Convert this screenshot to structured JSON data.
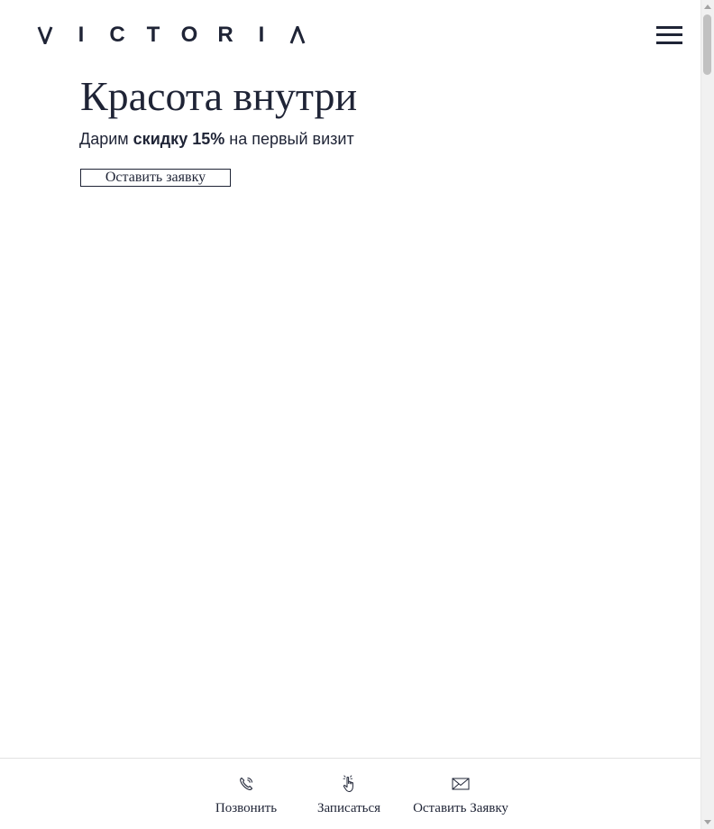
{
  "header": {
    "logo_letters": [
      "V",
      "I",
      "C",
      "T",
      "O",
      "R",
      "I",
      "Λ"
    ],
    "menu_icon": "hamburger-menu-icon"
  },
  "hero": {
    "title": "Красота внутри",
    "subtitle_before": "Дарим",
    "subtitle_bold": "скидку 15%",
    "subtitle_after": "на первый визит",
    "cta_label": "Оставить заявку"
  },
  "bottom_bar": {
    "items": [
      {
        "label": "Позвонить",
        "icon": "phone-icon"
      },
      {
        "label": "Записаться",
        "icon": "tap-hand-icon"
      },
      {
        "label": "Оставить Заявку",
        "icon": "envelope-icon"
      }
    ]
  },
  "colors": {
    "text": "#1f2436",
    "background": "#ffffff",
    "divider": "#e2e2e2"
  }
}
